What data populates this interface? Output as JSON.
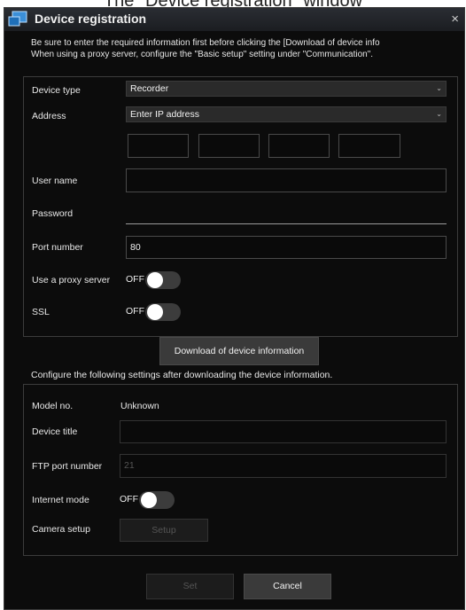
{
  "caption": "The \"Device registration\" window",
  "dialog": {
    "title": "Device registration",
    "close_glyph": "×",
    "icon": "app-window-icon",
    "intro_line1": "Be sure to enter the required information first before clicking the [Download of device info",
    "intro_line2": "When using a proxy server, configure the \"Basic setup\" setting under \"Communication\"."
  },
  "upper": {
    "device_type_label": "Device type",
    "device_type_value": "Recorder",
    "address_label": "Address",
    "address_value": "Enter IP address",
    "ip_octets": [
      "",
      "",
      "",
      ""
    ],
    "user_name_label": "User name",
    "user_name_value": "",
    "password_label": "Password",
    "password_value": "",
    "port_label": "Port number",
    "port_value": "80",
    "proxy_label": "Use a proxy server",
    "proxy_state": "OFF",
    "ssl_label": "SSL",
    "ssl_state": "OFF",
    "chevron": "⌄"
  },
  "download_button": "Download of device information",
  "note": "Configure the following settings after downloading the device information.",
  "lower": {
    "model_label": "Model no.",
    "model_value": "Unknown",
    "title_label": "Device title",
    "title_value": "",
    "ftp_label": "FTP port number",
    "ftp_value": "21",
    "internet_label": "Internet mode",
    "internet_state": "OFF",
    "camera_label": "Camera setup",
    "setup_button": "Setup"
  },
  "footer": {
    "set_button": "Set",
    "cancel_button": "Cancel"
  },
  "colors": {
    "background": "#0c0c0c",
    "titlebar": "#1b1d21",
    "toggle_track": "#3c3c3c"
  }
}
